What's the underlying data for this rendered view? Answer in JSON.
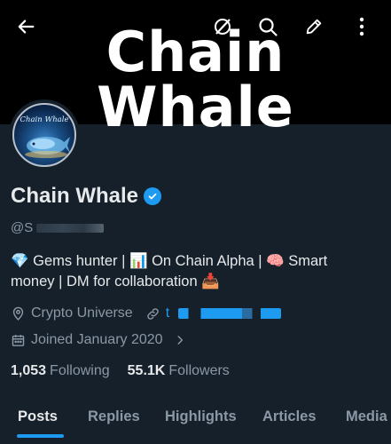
{
  "banner": {
    "title": "Chain Whale"
  },
  "avatar": {
    "text": "Chain Whale"
  },
  "profile": {
    "name": "Chain Whale",
    "handle": "@S",
    "bio_line1": "💎 Gems hunter | 📊 On Chain Alpha | 🧠 Smart",
    "bio_line2": "money | DM for collaboration 📥",
    "location": "Crypto Universe",
    "link": "t",
    "joined": "Joined January 2020"
  },
  "stats": {
    "following_count": "1,053",
    "following_label": "Following",
    "followers_count": "55.1K",
    "followers_label": "Followers"
  },
  "tabs": [
    {
      "label": "Posts"
    },
    {
      "label": "Replies"
    },
    {
      "label": "Highlights"
    },
    {
      "label": "Articles"
    },
    {
      "label": "Media"
    }
  ],
  "colors": {
    "accent": "#1d9bf0",
    "background": "#15202b",
    "muted": "#8b98a5"
  },
  "icons": [
    "back-arrow-icon",
    "grok-icon",
    "search-icon",
    "edit-icon",
    "more-vertical-icon",
    "verified-badge-icon",
    "location-icon",
    "link-icon",
    "calendar-icon",
    "chevron-right-icon"
  ]
}
